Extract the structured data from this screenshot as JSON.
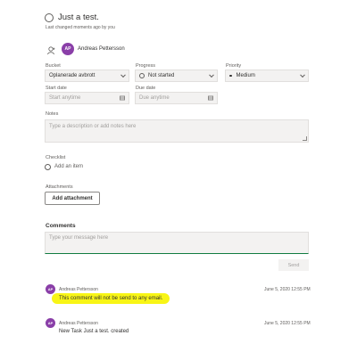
{
  "task": {
    "title": "Just a test.",
    "last_changed": "Last changed moments ago by you"
  },
  "assignee": {
    "initials": "AP",
    "name": "Andreas Pettersson"
  },
  "fields": {
    "bucket_label": "Bucket",
    "bucket_value": "Oplanerade avbrott",
    "progress_label": "Progress",
    "progress_value": "Not started",
    "priority_label": "Priority",
    "priority_value": "Medium",
    "start_label": "Start date",
    "start_placeholder": "Start anytime",
    "due_label": "Due date",
    "due_placeholder": "Due anytime"
  },
  "notes": {
    "label": "Notes",
    "placeholder": "Type a description or add notes here"
  },
  "checklist": {
    "label": "Checklist",
    "add_item": "Add an item"
  },
  "attachments": {
    "label": "Attachments",
    "button": "Add attachment"
  },
  "comments": {
    "label": "Comments",
    "placeholder": "Type your message here",
    "send": "Send",
    "items": [
      {
        "initials": "AP",
        "author": "Andreas Pettersson",
        "date": "June 5, 2020 12:55 PM",
        "text": "This comment will not be send to any email.",
        "highlight": "#f8f516"
      },
      {
        "initials": "AP",
        "author": "Andreas Pettersson",
        "date": "June 5, 2020 12:55 PM",
        "text": "New Task Just a test. created"
      }
    ]
  },
  "colors": {
    "avatar": "#8a3fa8",
    "comment_underline": "#107c41"
  }
}
